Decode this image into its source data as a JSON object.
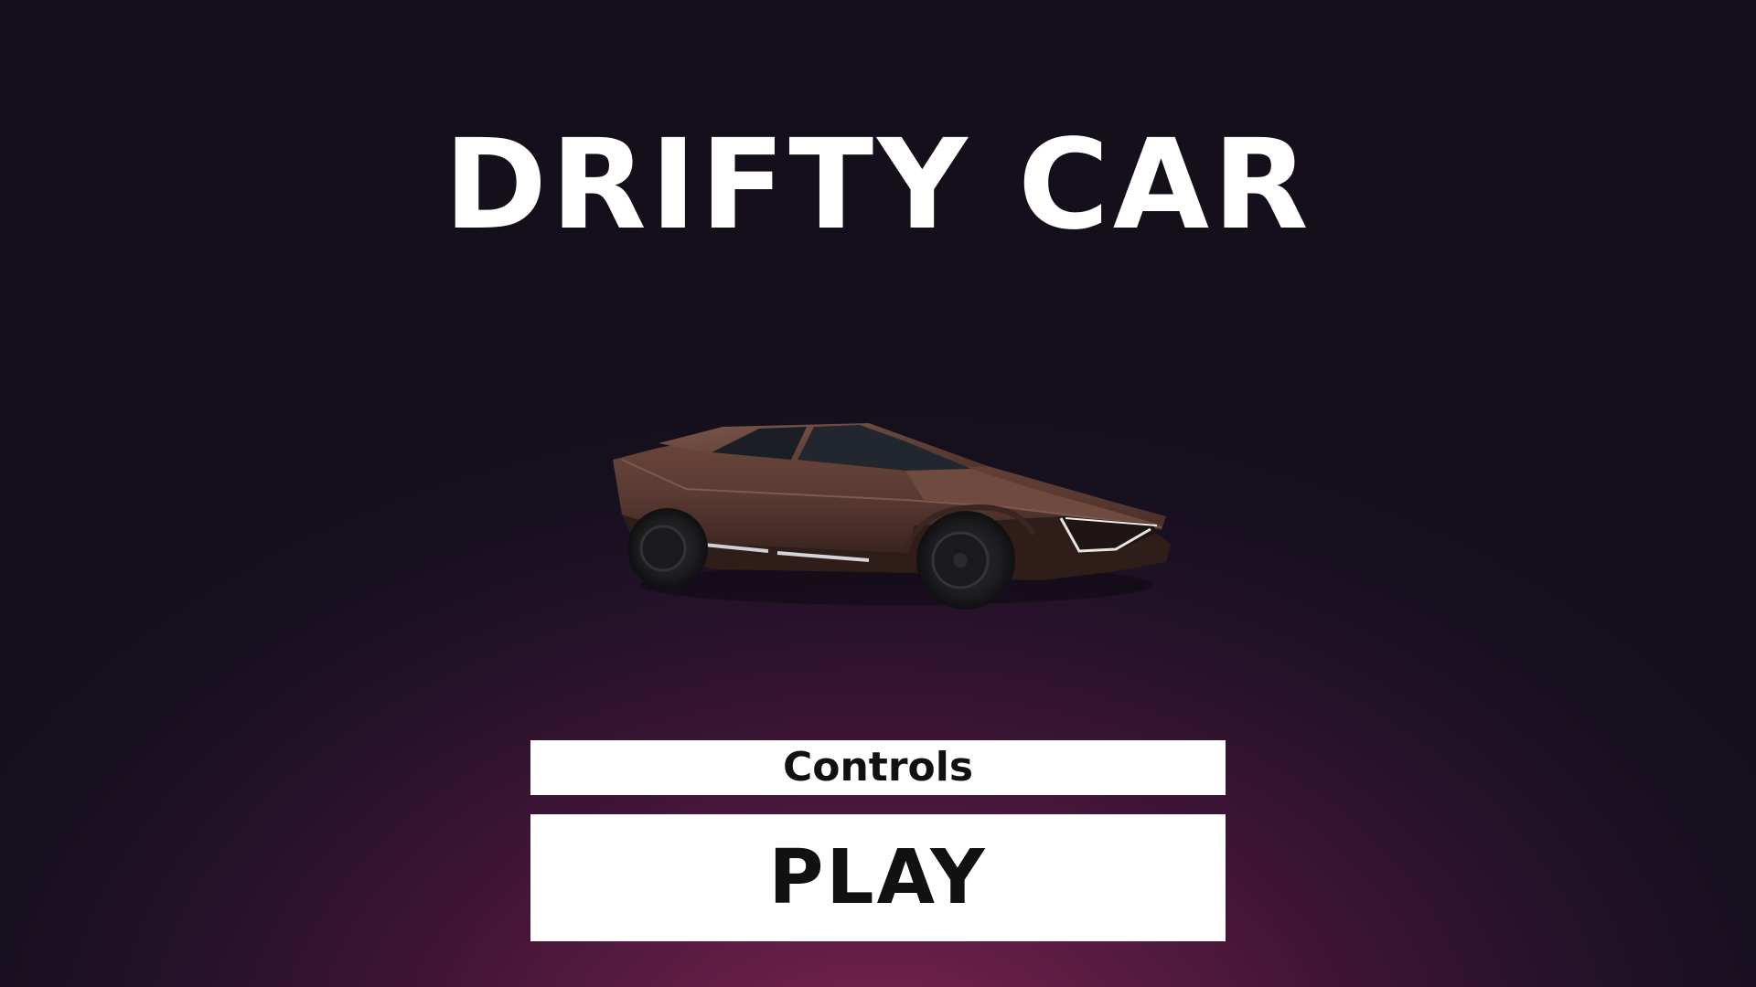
{
  "menu": {
    "title": "DRIFTY CAR",
    "controls_label": "Controls",
    "play_label": "PLAY"
  },
  "colors": {
    "button_background": "#ffffff",
    "button_text": "#111111",
    "title_text": "#ffffff",
    "car_body": "#5a3a32"
  }
}
